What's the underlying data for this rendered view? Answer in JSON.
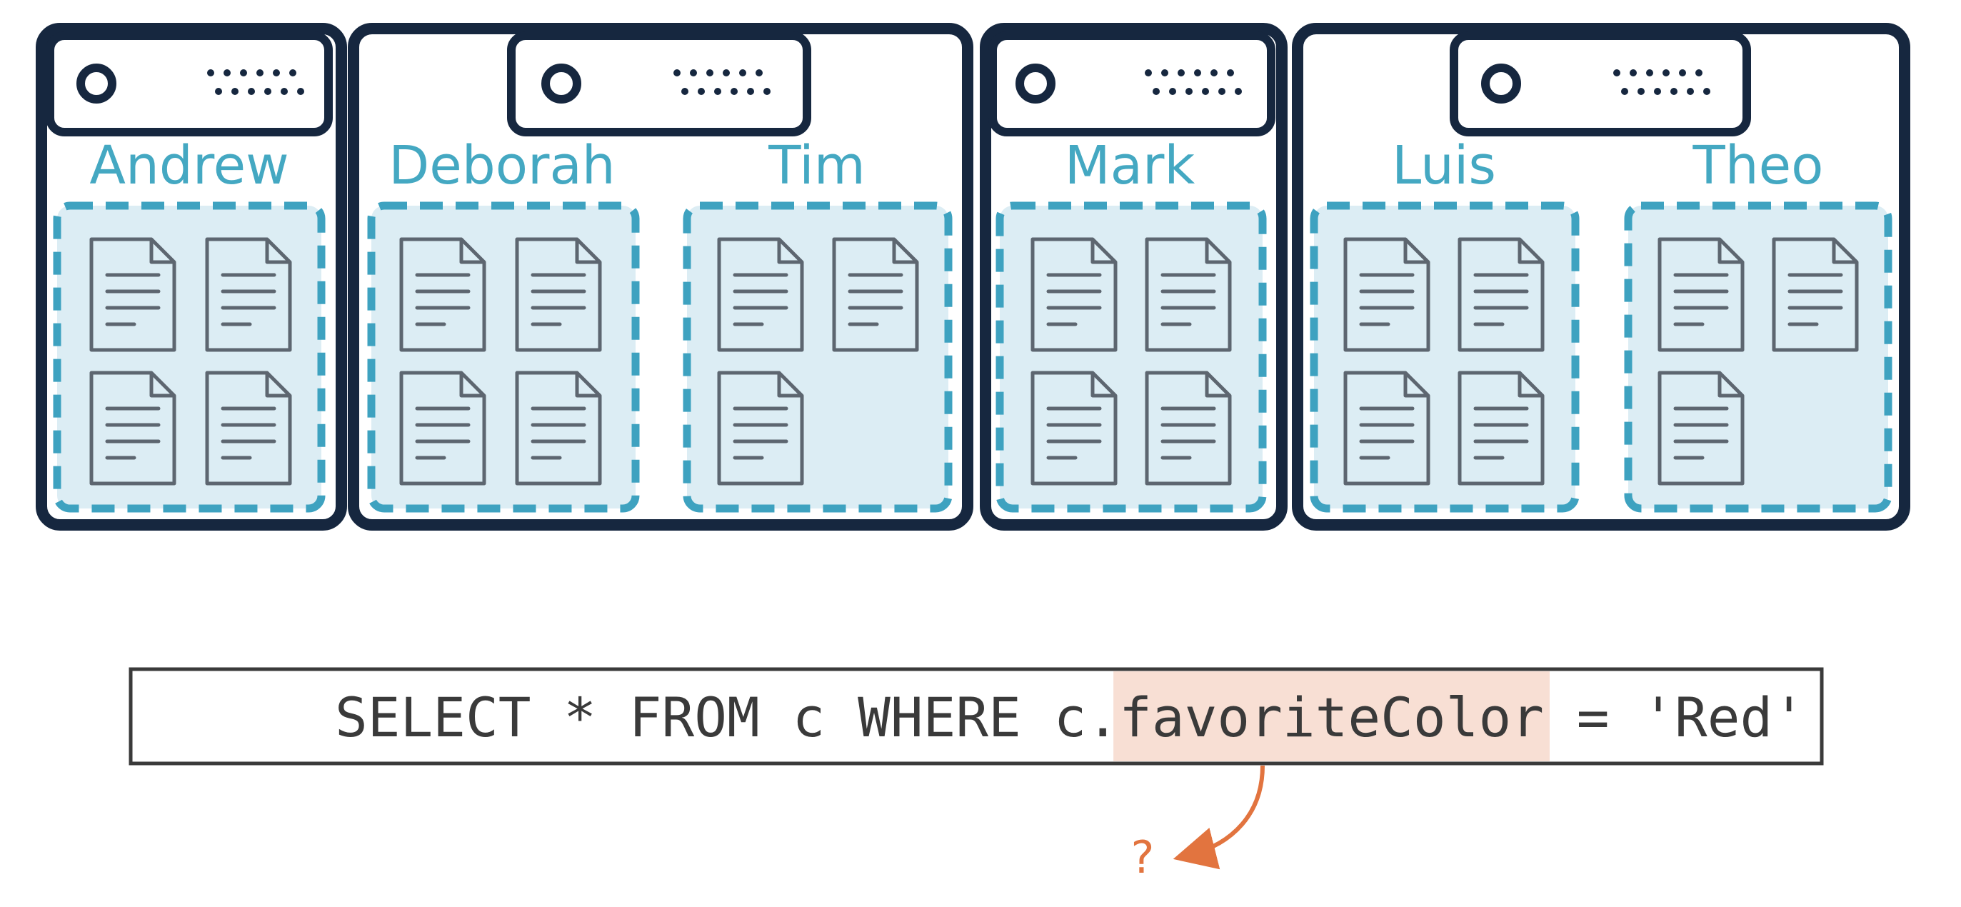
{
  "colors": {
    "server_stroke": "#16273f",
    "partition_stroke": "#3ea2c0",
    "partition_fill": "#dcedf4",
    "label": "#44a8c2",
    "document_stroke": "#5d6670",
    "highlight": "#f8dfd4",
    "arrow": "#e2743f",
    "query_text": "#3a3a3a"
  },
  "servers": [
    {
      "partitions": [
        {
          "name": "Andrew",
          "documents": 4
        }
      ]
    },
    {
      "partitions": [
        {
          "name": "Deborah",
          "documents": 4
        },
        {
          "name": "Tim",
          "documents": 3
        }
      ]
    },
    {
      "partitions": [
        {
          "name": "Mark",
          "documents": 4
        }
      ]
    },
    {
      "partitions": [
        {
          "name": "Luis",
          "documents": 4
        },
        {
          "name": "Theo",
          "documents": 3
        }
      ]
    }
  ],
  "query": {
    "prefix": "SELECT * FROM c WHERE c.",
    "highlight": "favoriteColor",
    "suffix": " = 'Red'"
  },
  "question_mark": "?"
}
